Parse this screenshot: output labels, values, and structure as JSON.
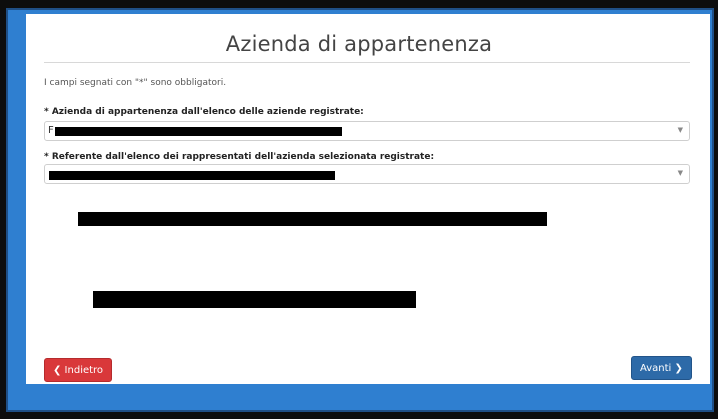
{
  "page": {
    "title": "Azienda di appartenenza",
    "required_hint": "I campi segnati con \"*\" sono obbligatori."
  },
  "fields": [
    {
      "label": "* Azienda di appartenenza dall'elenco delle aziende registrate:",
      "value_prefix": "F"
    },
    {
      "label": "* Referente dall'elenco dei rappresentati dell'azienda selezionata registrate:",
      "value_prefix": ""
    }
  ],
  "buttons": {
    "back": "❮ Indietro",
    "next": "Avanti ❯"
  },
  "colors": {
    "frame": "#2f7fd0",
    "back_button": "#d9383a",
    "next_button": "#2d6aa8"
  }
}
